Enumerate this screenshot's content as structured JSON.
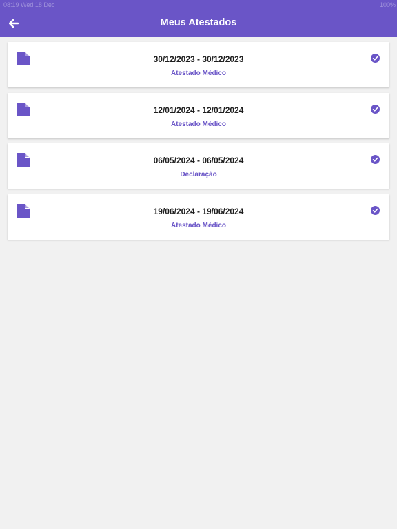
{
  "status_bar": {
    "left_text": "08:19  Wed 18 Dec",
    "right_text": "100%"
  },
  "header": {
    "back_icon": "arrow-left-icon",
    "title": "Meus Atestados"
  },
  "colors": {
    "accent": "#6a55c7",
    "background": "#f1f1f1",
    "card": "#ffffff",
    "text": "#1e1e1e"
  },
  "certificates": [
    {
      "dates": "30/12/2023 - 30/12/2023",
      "type": "Atestado Médico",
      "status_icon": "check-circle-icon",
      "doc_icon": "document-icon"
    },
    {
      "dates": "12/01/2024 - 12/01/2024",
      "type": "Atestado Médico",
      "status_icon": "check-circle-icon",
      "doc_icon": "document-icon"
    },
    {
      "dates": "06/05/2024 - 06/05/2024",
      "type": "Declaração",
      "status_icon": "check-circle-icon",
      "doc_icon": "document-icon"
    },
    {
      "dates": "19/06/2024 - 19/06/2024",
      "type": "Atestado Médico",
      "status_icon": "check-circle-icon",
      "doc_icon": "document-icon"
    }
  ]
}
